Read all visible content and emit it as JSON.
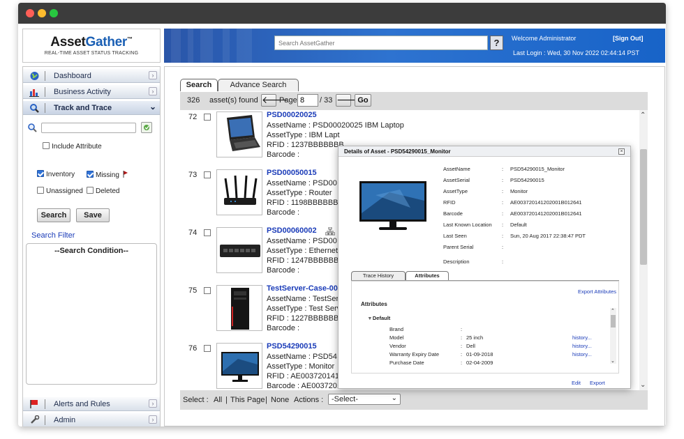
{
  "app": {
    "brand_part1": "Asset",
    "brand_part2": "Gather",
    "brand_tm": "™",
    "tagline": "REAL-TIME ASSET STATUS TRACKING"
  },
  "header": {
    "search_placeholder": "Search AssetGather",
    "help_label": "?",
    "welcome": "Welcome  Administrator",
    "sign_out": "[Sign Out]",
    "last_login": "Last Login :  Wed, 30 Nov 2022 02:44:14 PST"
  },
  "sidebar": {
    "items": [
      {
        "label": "Dashboard",
        "icon": "globe-icon"
      },
      {
        "label": "Business Activity",
        "icon": "bar-chart-icon"
      },
      {
        "label": "Track and Trace",
        "icon": "magnifier-icon"
      },
      {
        "label": "Alerts and Rules",
        "icon": "flag-icon"
      },
      {
        "label": "Admin",
        "icon": "wrench-icon"
      }
    ],
    "include_attribute": "Include Attribute",
    "filters": {
      "inventory": "Inventory",
      "missing": "Missing",
      "unassigned": "Unassigned",
      "deleted": "Deleted"
    },
    "search_button": "Search",
    "save_button": "Save",
    "search_filter": "Search Filter",
    "search_condition": "--Search Condition--"
  },
  "main": {
    "tabs": [
      "Search",
      "Advance Search"
    ],
    "count": "326",
    "count_label": "asset(s) found",
    "page_label": "Page",
    "page_value": "8",
    "page_total": "/ 33",
    "go_label": "Go",
    "rows": [
      {
        "num": "72",
        "name": "PSD00020025",
        "asset_name": "AssetName :  PSD00020025 IBM Laptop",
        "asset_type": "AssetType :  IBM Lapt",
        "rfid": "RFID :  1237BBBBBBB",
        "barcode": "Barcode :",
        "image": "laptop"
      },
      {
        "num": "73",
        "name": "PSD00050015",
        "asset_name": "AssetName :  PSD00",
        "asset_type": "AssetType :  Router",
        "rfid": "RFID :  1198BBBBBBB",
        "barcode": "Barcode :",
        "image": "router"
      },
      {
        "num": "74",
        "name": "PSD00060002",
        "asset_name": "AssetName :  PSD00",
        "asset_type": "AssetType :  Ethernet",
        "rfid": "RFID :  1247BBBBBBB",
        "barcode": "Barcode :",
        "image": "switch"
      },
      {
        "num": "75",
        "name": "TestServer-Case-00",
        "asset_name": "AssetName :  TestSer",
        "asset_type": "AssetType :  Test Serv",
        "rfid": "RFID :  1227BBBBBBB",
        "barcode": "Barcode :",
        "image": "server"
      },
      {
        "num": "76",
        "name": "PSD54290015",
        "asset_name": "AssetName :  PSD54",
        "asset_type": "AssetType :  Monitor",
        "rfid": "RFID :  AE00372014120200 1B012641",
        "barcode": "Barcode :  AE0037201412020 01B012641",
        "image": "monitor"
      }
    ],
    "footer": {
      "select_label": "Select :",
      "all": "All",
      "this_page": "This Page",
      "none": "None",
      "actions_label": "Actions :",
      "actions_value": "-Select-"
    }
  },
  "modal": {
    "title": "Details of Asset - PSD54290015_Monitor",
    "fields": [
      {
        "k": "AssetName",
        "v": "PSD54290015_Monitor"
      },
      {
        "k": "AssetSerial",
        "v": "PSD54290015"
      },
      {
        "k": "AssetType",
        "v": "Monitor"
      },
      {
        "k": "RFID",
        "v": "AE003720141202001B012641"
      },
      {
        "k": "Barcode",
        "v": "AE003720141202001B012641"
      },
      {
        "k": "Last Known Location",
        "v": "Default"
      },
      {
        "k": "Last Seen",
        "v": "Sun, 20 Aug 2017 22:38:47 PDT"
      },
      {
        "k": "Parent Serial",
        "v": ""
      },
      {
        "k": "Description",
        "v": ""
      }
    ],
    "tabs": [
      "Trace History",
      "Attributes"
    ],
    "export_attributes": "Export Attributes",
    "attributes_title": "Attributes",
    "group": "Default",
    "attrs": [
      {
        "k": "Brand",
        "v": "",
        "link": ""
      },
      {
        "k": "Model",
        "v": "25 inch",
        "link": "history..."
      },
      {
        "k": "Vendor",
        "v": "Dell",
        "link": "history..."
      },
      {
        "k": "Warranty Expiry Date",
        "v": "01-09-2018",
        "link": "history..."
      },
      {
        "k": "Purchase Date",
        "v": "02-04-2009",
        "link": ""
      }
    ],
    "edit": "Edit",
    "export": "Export"
  }
}
